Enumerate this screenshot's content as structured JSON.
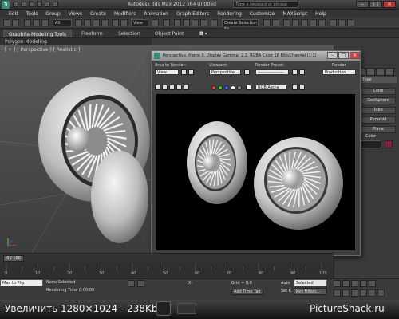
{
  "app": {
    "title": "Autodesk 3ds Max  2012 x64    Untitled",
    "search_placeholder": "Type a keyword or phrase",
    "logo_letter": "3"
  },
  "menu": [
    "Edit",
    "Tools",
    "Group",
    "Views",
    "Create",
    "Modifiers",
    "Animation",
    "Graph Editors",
    "Rendering",
    "Customize",
    "MAXScript",
    "Help"
  ],
  "toolbar": {
    "selection_filter": "All",
    "view_coord": "View",
    "named_selection": "Create Selection Se"
  },
  "ribbon": {
    "tabs": [
      "Graphite Modeling Tools",
      "Freeform",
      "Selection",
      "Object Paint"
    ],
    "active_tab": "Graphite Modeling Tools",
    "sub_label": "Polygon Modeling"
  },
  "viewport": {
    "label": "[ + ] [ Perspective ] [ Realistic ]"
  },
  "command_panel": {
    "dropdown": "Type",
    "buttons": [
      "Cone",
      "GeoSphere",
      "Tube",
      "Pyramid",
      "Plane"
    ],
    "color_label": "Color"
  },
  "render_window": {
    "title": "Perspective, frame 0, Display Gamma: 2.2, RGBA Color 16 Bits/Channel (1:1)",
    "area_label": "Area to Render:",
    "area_value": "View",
    "viewport_label": "Viewport:",
    "viewport_value": "Perspective",
    "preset_label": "Render Preset:",
    "preset_value": "------------------",
    "render_button": "Render",
    "production_value": "Production",
    "channel_value": "RGB Alpha"
  },
  "timeline": {
    "slider_text": "0 / 100",
    "ticks": [
      "0",
      "10",
      "20",
      "30",
      "40",
      "50",
      "60",
      "70",
      "80",
      "90",
      "100"
    ]
  },
  "status": {
    "maxscript": "Max to Phy",
    "selection": "None Selected",
    "prompt": "Rendering Time 0:00:00",
    "x_label": "X:",
    "grid": "Grid = 0,0",
    "add_time_tag": "Add Time Tag",
    "auto_key": "Auto",
    "set_key": "Set K.",
    "auto_key_value": "Selected",
    "key_filters": "Key Filters..."
  },
  "watermark": {
    "left": "Увеличить   1280×1024 - 238Kb",
    "right": "PictureShack.ru"
  }
}
